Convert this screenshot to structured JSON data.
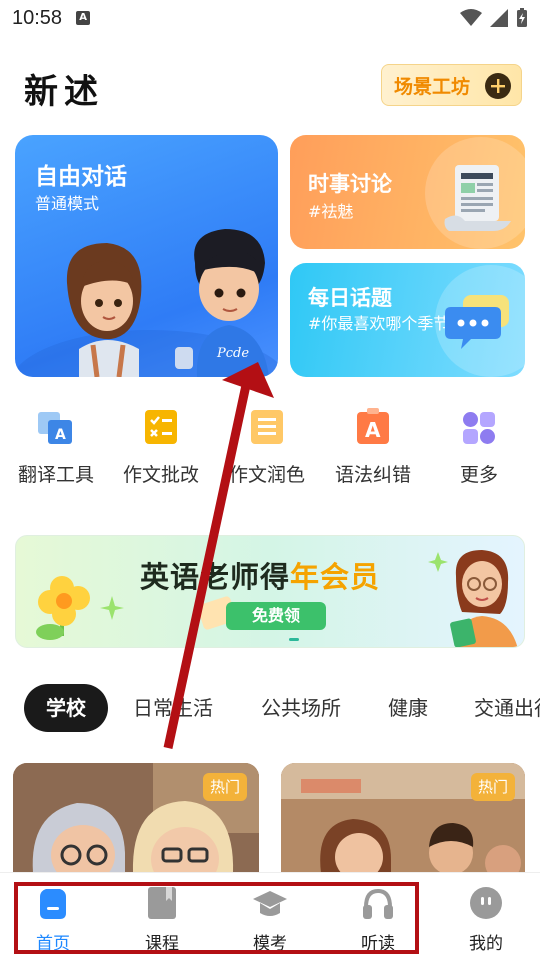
{
  "status_bar": {
    "time": "10:58",
    "notification_icon": "A"
  },
  "header": {
    "title": "新述",
    "scene_button_label": "场景工坊"
  },
  "cards": {
    "free_talk": {
      "title": "自由对话",
      "subtitle": "普通模式"
    },
    "news_discussion": {
      "title": "时事讨论",
      "subtitle": "#祛魅"
    },
    "daily_topic": {
      "title": "每日话题",
      "subtitle": "#你最喜欢哪个季节"
    }
  },
  "tools": [
    {
      "label": "翻译工具",
      "icon": "translate-icon",
      "color": "#4a90e2"
    },
    {
      "label": "作文批改",
      "icon": "essay-check-icon",
      "color": "#f7b500"
    },
    {
      "label": "作文润色",
      "icon": "essay-polish-icon",
      "color": "#ffb74d"
    },
    {
      "label": "语法纠错",
      "icon": "grammar-icon",
      "color": "#ff7043"
    },
    {
      "label": "更多",
      "icon": "more-icon",
      "color": "#8e7cf0"
    }
  ],
  "banner": {
    "title_prefix": "英语老师得",
    "title_highlight": "年会员",
    "button_label": "免费领"
  },
  "tabs": [
    "学校",
    "日常生活",
    "公共场所",
    "健康",
    "交通出行"
  ],
  "active_tab": "学校",
  "scene_cards": [
    {
      "badge": "热门"
    },
    {
      "badge": "热门"
    }
  ],
  "bottom_nav": [
    {
      "label": "首页",
      "icon": "home-icon",
      "active": true
    },
    {
      "label": "课程",
      "icon": "book-icon",
      "active": false
    },
    {
      "label": "模考",
      "icon": "mortarboard-icon",
      "active": false
    },
    {
      "label": "听读",
      "icon": "headphones-icon",
      "active": false
    },
    {
      "label": "我的",
      "icon": "profile-icon",
      "active": false
    }
  ],
  "colors": {
    "accent": "#1e88ff",
    "annotation": "#b30f14",
    "highlight": "#f5a300"
  }
}
